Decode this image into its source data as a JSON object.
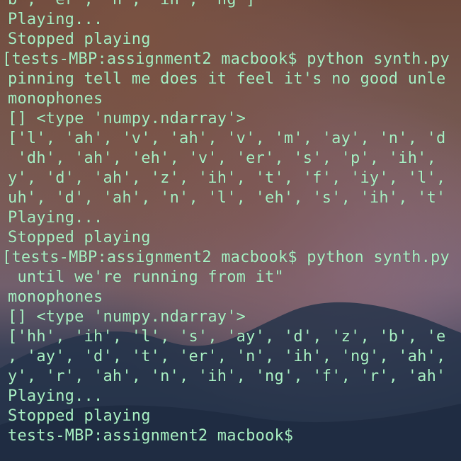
{
  "terminal": {
    "lines": [
      {
        "text": "b', 'er', 'n', 'ih', 'ng']",
        "kind": "output"
      },
      {
        "text": "Playing...",
        "kind": "output"
      },
      {
        "text": "Stopped playing",
        "kind": "output"
      },
      {
        "text": "[tests-MBP:assignment2 macbook$ python synth.py",
        "kind": "prompt"
      },
      {
        "text": "pinning tell me does it feel it's no good unle",
        "kind": "output"
      },
      {
        "text": "monophones",
        "kind": "output"
      },
      {
        "text": "[] <type 'numpy.ndarray'>",
        "kind": "output"
      },
      {
        "text": "['l', 'ah', 'v', 'ah', 'v', 'm', 'ay', 'n', 'd",
        "kind": "output"
      },
      {
        "text": " 'dh', 'ah', 'eh', 'v', 'er', 's', 'p', 'ih',",
        "kind": "output"
      },
      {
        "text": "y', 'd', 'ah', 'z', 'ih', 't', 'f', 'iy', 'l',",
        "kind": "output"
      },
      {
        "text": "uh', 'd', 'ah', 'n', 'l', 'eh', 's', 'ih', 't'",
        "kind": "output"
      },
      {
        "text": "Playing...",
        "kind": "output"
      },
      {
        "text": "Stopped playing",
        "kind": "output"
      },
      {
        "text": "[tests-MBP:assignment2 macbook$ python synth.py",
        "kind": "prompt"
      },
      {
        "text": " until we're running from it\"",
        "kind": "output"
      },
      {
        "text": "monophones",
        "kind": "output"
      },
      {
        "text": "[] <type 'numpy.ndarray'>",
        "kind": "output"
      },
      {
        "text": "['hh', 'ih', 'l', 's', 'ay', 'd', 'z', 'b', 'e",
        "kind": "output"
      },
      {
        "text": ", 'ay', 'd', 't', 'er', 'n', 'ih', 'ng', 'ah',",
        "kind": "output"
      },
      {
        "text": "y', 'r', 'ah', 'n', 'ih', 'ng', 'f', 'r', 'ah'",
        "kind": "output"
      },
      {
        "text": "Playing...",
        "kind": "output"
      },
      {
        "text": "Stopped playing",
        "kind": "output"
      },
      {
        "text": "tests-MBP:assignment2 macbook$",
        "kind": "prompt"
      }
    ]
  },
  "colors": {
    "text": "#a8f0c4",
    "background_top": "#6d4a3d",
    "background_bottom": "#243348"
  }
}
